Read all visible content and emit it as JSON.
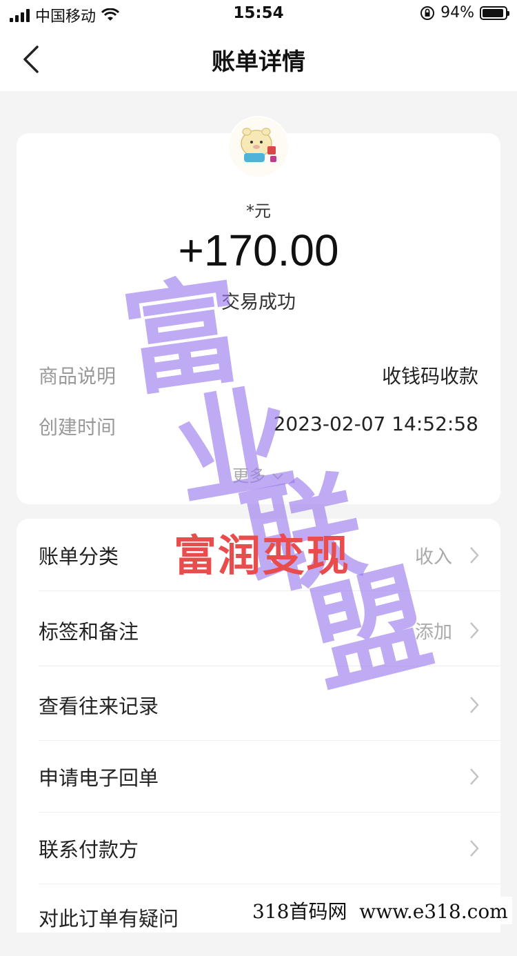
{
  "status_bar": {
    "carrier": "中国移动",
    "time": "15:54",
    "battery": "94%",
    "battery_level": 0.94
  },
  "nav": {
    "title": "账单详情"
  },
  "summary": {
    "unit": "*元",
    "amount": "+170.00",
    "status": "交易成功",
    "rows": [
      {
        "label": "商品说明",
        "value": "收钱码收款"
      },
      {
        "label": "创建时间",
        "value": "2023-02-07 14:52:58"
      }
    ],
    "more": "更多"
  },
  "actions": [
    {
      "label": "账单分类",
      "value": "收入"
    },
    {
      "label": "标签和备注",
      "value": "添加"
    },
    {
      "label": "查看往来记录",
      "value": ""
    },
    {
      "label": "申请电子回单",
      "value": ""
    },
    {
      "label": "联系付款方",
      "value": ""
    },
    {
      "label": "对此订单有疑问",
      "value": ""
    }
  ],
  "watermarks": {
    "purple": [
      "富",
      "业",
      "联",
      "盟"
    ],
    "red": "富润变现",
    "bottom": "318首码网  www.e318.com"
  },
  "colors": {
    "watermark_purple": "#9678eb",
    "watermark_red": "#e84c4c"
  }
}
